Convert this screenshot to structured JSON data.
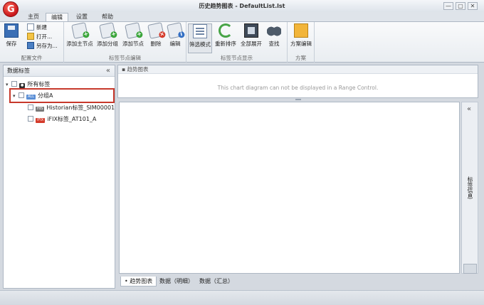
{
  "window": {
    "title": "历史趋势图表 - DefaultList.lst",
    "logo_letter": "G",
    "min_symbol": "—",
    "max_symbol": "▢",
    "close_symbol": "✕"
  },
  "ribbon_tabs": [
    {
      "label": "主页",
      "active": false
    },
    {
      "label": "编辑",
      "active": true
    },
    {
      "label": "设置",
      "active": false
    },
    {
      "label": "帮助",
      "active": false
    }
  ],
  "groups": {
    "config": {
      "label": "配置文件",
      "save": "保存",
      "new": "新建",
      "open": "打开...",
      "save_as": "另存为..."
    },
    "tag_edit": {
      "label": "标签节点编辑",
      "add_main": "添加主节点",
      "add_group": "添加分组",
      "add_node": "添加节点",
      "delete": "删除",
      "edit": "编辑"
    },
    "tag_display": {
      "label": "标签节点显示",
      "simple_mode": "筛选模式",
      "resort": "重新排序",
      "expand_all": "全部展开",
      "find": "查找"
    },
    "plan": {
      "label": "方案",
      "plan_edit": "方案编辑"
    }
  },
  "left_panel": {
    "title": "数据标签",
    "collapse": "«",
    "tree": {
      "root": {
        "label": "所有标签"
      },
      "group": {
        "label": "分组A",
        "badge": "ALL"
      },
      "children": [
        {
          "badge": "HIS",
          "label": "Historian标签_SIM00001",
          "color": "#7a7a7a"
        },
        {
          "badge": "IFIX",
          "label": "iFIX标签_AT101_A",
          "color": "#d43a2a"
        }
      ]
    }
  },
  "range_panel": {
    "title": "趋势图表",
    "message": "This chart diagram can not be displayed in a Range Control."
  },
  "bottom_tabs": [
    {
      "label": "趋势图表",
      "active": true
    },
    {
      "label": "数据（明细）",
      "active": false
    },
    {
      "label": "数据（汇总）",
      "active": false
    }
  ],
  "right_panel": {
    "collapse": "«",
    "label": "标签信息"
  }
}
